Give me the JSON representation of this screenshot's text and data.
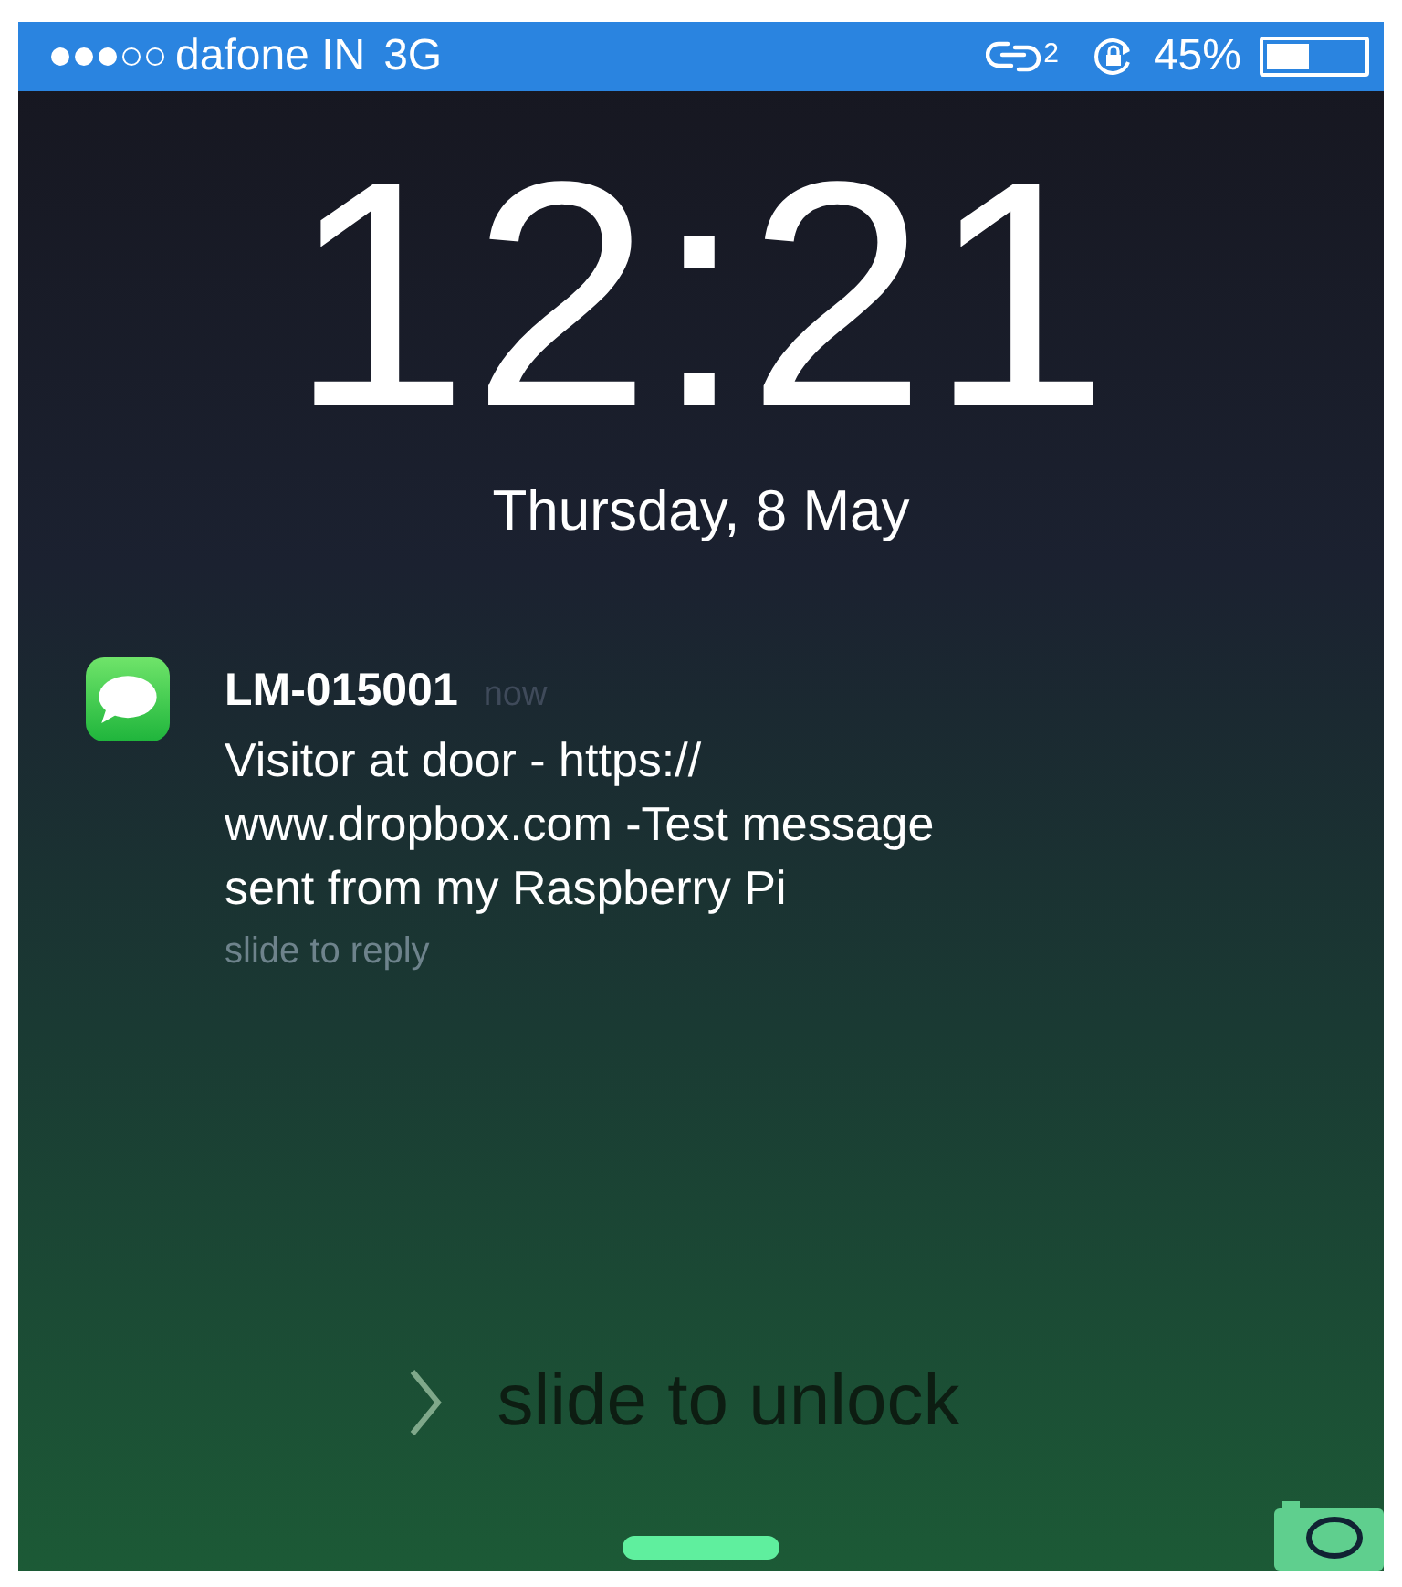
{
  "status_bar": {
    "signal_dots": [
      {
        "filled": true
      },
      {
        "filled": true
      },
      {
        "filled": true
      },
      {
        "filled": false
      },
      {
        "filled": false
      }
    ],
    "carrier": "dafone IN",
    "network": "3G",
    "link_count": "2",
    "battery_percent": "45%",
    "battery": {
      "level": 0.45
    }
  },
  "clock": {
    "time": "12:21",
    "date": "Thursday, 8 May"
  },
  "notification": {
    "sender": "LM-015001",
    "time": "now",
    "message": "Visitor at door - https://\nwww.dropbox.com -Test message\nsent from my Raspberry Pi",
    "action_hint": "slide to reply"
  },
  "unlock": {
    "label": "slide to unlock"
  }
}
